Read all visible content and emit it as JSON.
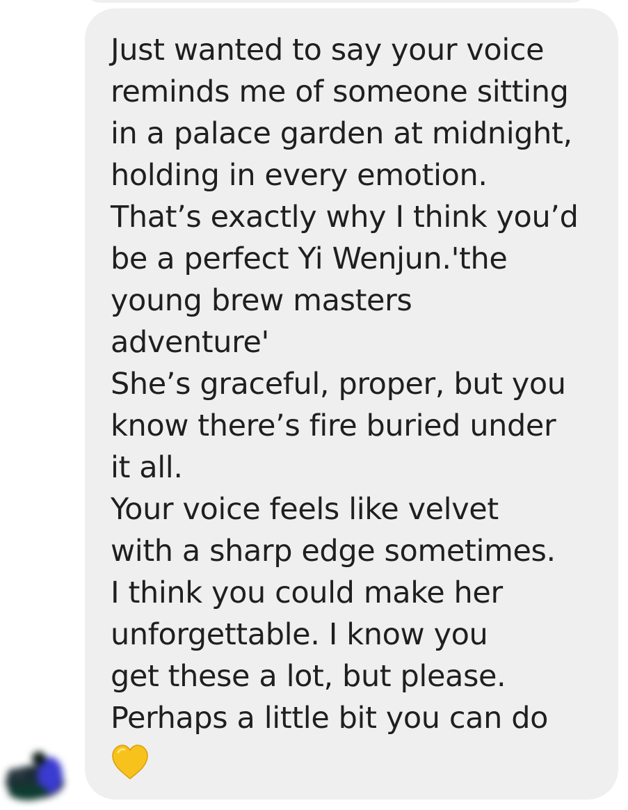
{
  "conversation": {
    "message": {
      "lines": [
        "Just wanted to say your voice",
        "reminds me of someone sitting",
        "in a palace garden at midnight,",
        "holding in every emotion.",
        "That’s exactly why I think you’d",
        "be a perfect Yi Wenjun.'the",
        "young brew masters",
        "adventure'",
        "She’s graceful, proper, but you",
        "know there’s fire buried under",
        "it all.",
        "Your voice feels like velvet",
        "with a sharp edge sometimes.",
        "I think you could make her",
        "unforgettable. I know you",
        "get these a lot, but please.",
        "Perhaps a little bit you can do"
      ],
      "emoji": "yellow-heart-icon"
    },
    "sender": {
      "avatar": "blurred-avatar"
    }
  },
  "colors": {
    "bubble": "#efefef",
    "text": "#1f1f1f",
    "heart": "#f7c21b"
  }
}
